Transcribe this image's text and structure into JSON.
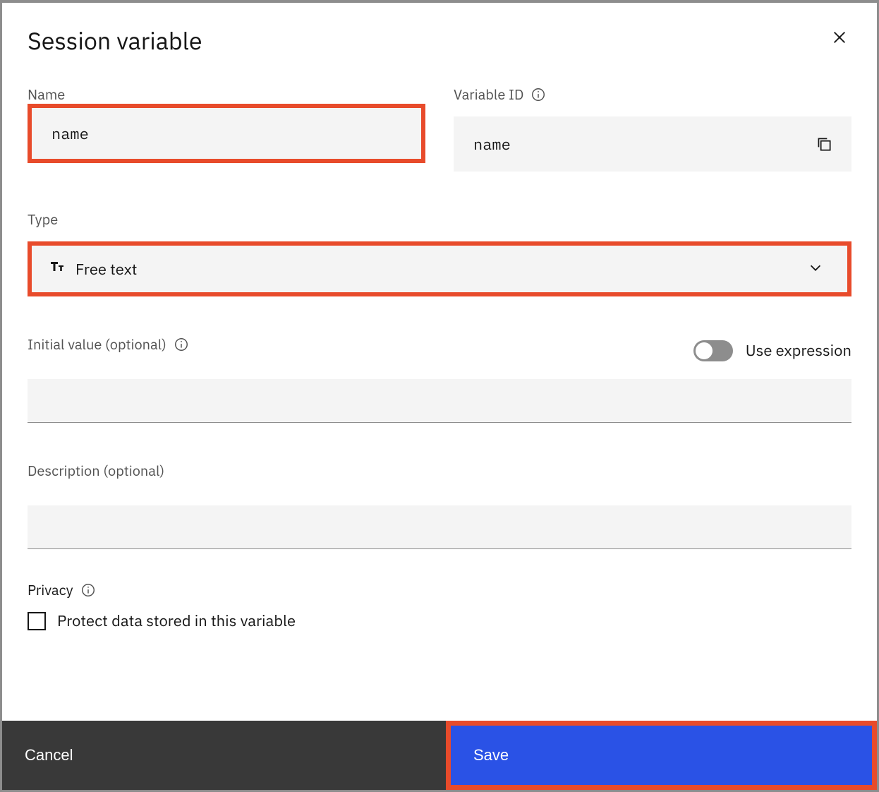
{
  "dialog": {
    "title": "Session variable"
  },
  "name_field": {
    "label": "Name",
    "value": "name"
  },
  "variable_id": {
    "label": "Variable ID",
    "value": "name"
  },
  "type_field": {
    "label": "Type",
    "selected": "Free text"
  },
  "initial_value": {
    "label": "Initial value (optional)",
    "toggle_label": "Use expression",
    "toggle_on": false,
    "value": ""
  },
  "description": {
    "label": "Description (optional)",
    "value": ""
  },
  "privacy": {
    "label": "Privacy",
    "checkbox_label": "Protect data stored in this variable",
    "checked": false
  },
  "footer": {
    "cancel": "Cancel",
    "save": "Save"
  }
}
